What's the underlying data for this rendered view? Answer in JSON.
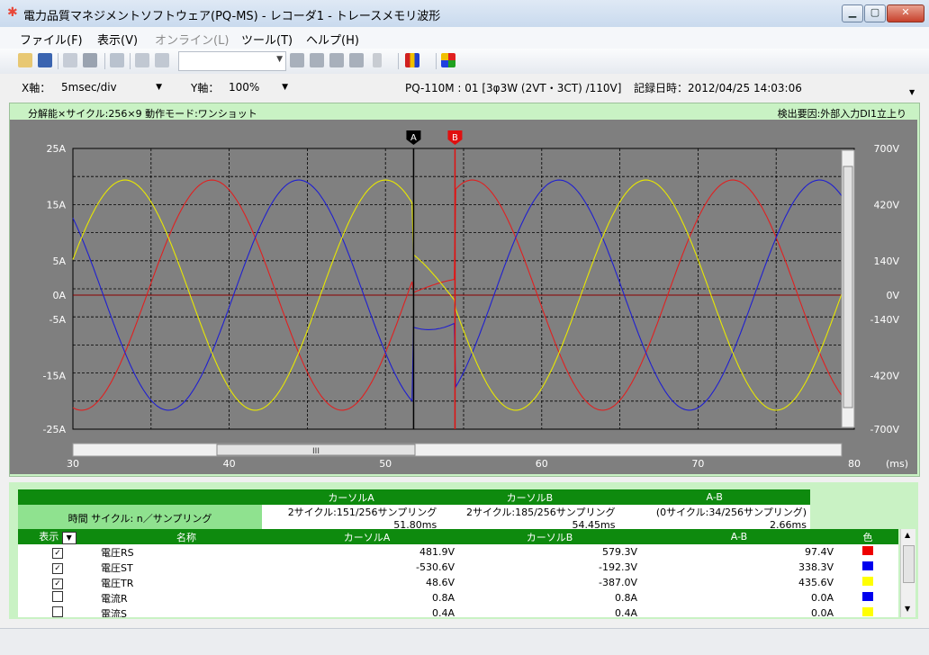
{
  "window": {
    "title": "電力品質マネジメントソフトウェア(PQ-MS) - レコーダ1 - トレースメモリ波形"
  },
  "menu": [
    "ファイル(F)",
    "表示(V)",
    "オンライン(L)",
    "ツール(T)",
    "ヘルプ(H)"
  ],
  "axis_settings": {
    "x_label": "X軸：",
    "x_value": "5msec/div",
    "y_label": "Y軸：",
    "y_value": "100%",
    "device_info": "PQ-110M : 01 [3φ3W (2VT・3CT) /110V]",
    "record_time": "記録日時：2012/04/25 14:03:06"
  },
  "chart_header": {
    "left": "分解能×サイクル:256×9 動作モード:ワンショット",
    "right": "検出要因:外部入力DI1立上り"
  },
  "chart_data": {
    "type": "line",
    "x_range": [
      30,
      80
    ],
    "x_unit_label": "(ms)",
    "x_ticks": [
      "30",
      "40",
      "50",
      "60",
      "70",
      "80"
    ],
    "y_left_ticks": [
      "25A",
      "15A",
      "5A",
      "0A",
      "-5A",
      "-15A",
      "-25A"
    ],
    "y_right_ticks": [
      "700V",
      "420V",
      "140V",
      "0V",
      "-140V",
      "-420V",
      "-700V"
    ],
    "cursors": [
      {
        "name": "A",
        "x_ms": 51.8
      },
      {
        "name": "B",
        "x_ms": 54.45
      }
    ],
    "series": [
      {
        "color": "#e02020",
        "amplitude_v": 580,
        "phase_deg": -30
      },
      {
        "color": "#1f1fd0",
        "amplitude_v": 580,
        "phase_deg": -150
      },
      {
        "color": "#e8e800",
        "amplitude_v": 580,
        "phase_deg": 90
      }
    ],
    "scroll_label": "III"
  },
  "colors": {
    "red": "#ee0000",
    "blue": "#0000ee",
    "yellow": "#ffff00",
    "header_green": "#0e8a0e",
    "panel_green": "#c9f2c4"
  },
  "cursor_table": {
    "headers": [
      "カーソルA",
      "カーソルB",
      "A-B"
    ],
    "row_label": "時間 サイクル: n／サンプリング",
    "values": [
      "2サイクル:151/256サンプリング 51.80ms",
      "2サイクル:185/256サンプリング 54.45ms",
      "(0サイクル:34/256サンプリング) 2.66ms"
    ]
  },
  "value_table": {
    "headers": [
      "表示",
      "名称",
      "カーソルA",
      "カーソルB",
      "A-B",
      "色"
    ],
    "rows": [
      {
        "checked": true,
        "name": "電圧RS",
        "a": "481.9V",
        "b": "579.3V",
        "ab": "97.4V",
        "color": "#ee0000"
      },
      {
        "checked": true,
        "name": "電圧ST",
        "a": "-530.6V",
        "b": "-192.3V",
        "ab": "338.3V",
        "color": "#0000ee"
      },
      {
        "checked": true,
        "name": "電圧TR",
        "a": "48.6V",
        "b": "-387.0V",
        "ab": "435.6V",
        "color": "#ffff00"
      },
      {
        "checked": false,
        "name": "電流R",
        "a": "0.8A",
        "b": "0.8A",
        "ab": "0.0A",
        "color": "#0000ee"
      },
      {
        "checked": false,
        "name": "電流S",
        "a": "0.4A",
        "b": "0.4A",
        "ab": "0.0A",
        "color": "#ffff00"
      }
    ]
  }
}
